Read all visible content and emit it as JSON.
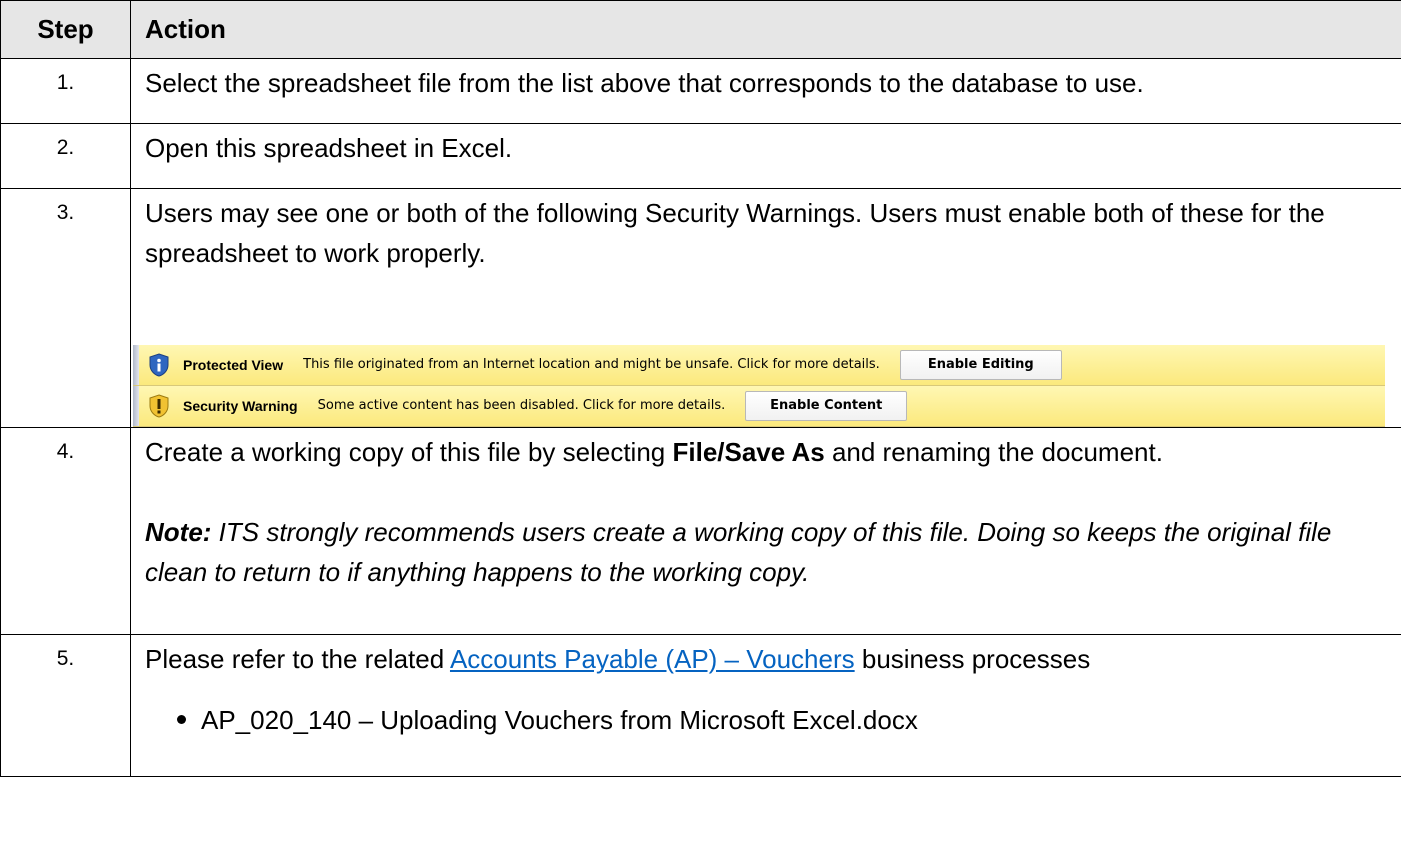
{
  "header": {
    "step": "Step",
    "action": "Action"
  },
  "rows": [
    {
      "num": "1.",
      "text": "Select the spreadsheet file from the list above that corresponds to the database to use."
    },
    {
      "num": "2.",
      "text": "Open this spreadsheet in Excel."
    },
    {
      "num": "3.",
      "text": "Users may see one or both of the following Security Warnings.  Users must enable both of these for the spreadsheet to work properly."
    },
    {
      "num": "4.",
      "before": "Create a working copy of this file by selecting ",
      "bold": "File/Save As",
      "after": " and renaming the document.",
      "note_label": "Note:",
      "note_text": " ITS strongly recommends users create a working copy of this file. Doing so keeps the original file clean to return to if anything happens to the working copy."
    },
    {
      "num": "5.",
      "before": "Please refer to the related ",
      "link": "Accounts Payable (AP) – Vouchers",
      "after": " business processes",
      "bullet": "AP_020_140 – Uploading Vouchers from Microsoft Excel.docx"
    }
  ],
  "message_bars": {
    "protected_view": {
      "icon": "info-shield-icon",
      "title": "Protected View",
      "message": "This file originated from an Internet location and might be unsafe. Click for more details.",
      "button": "Enable Editing"
    },
    "security_warning": {
      "icon": "warning-shield-icon",
      "title": "Security Warning",
      "message": "Some active content has been disabled. Click for more details.",
      "button": "Enable Content"
    }
  },
  "colors": {
    "header_bg": "#e6e6e6",
    "link": "#0563c1",
    "bar_yellow": "#fbe97d"
  }
}
